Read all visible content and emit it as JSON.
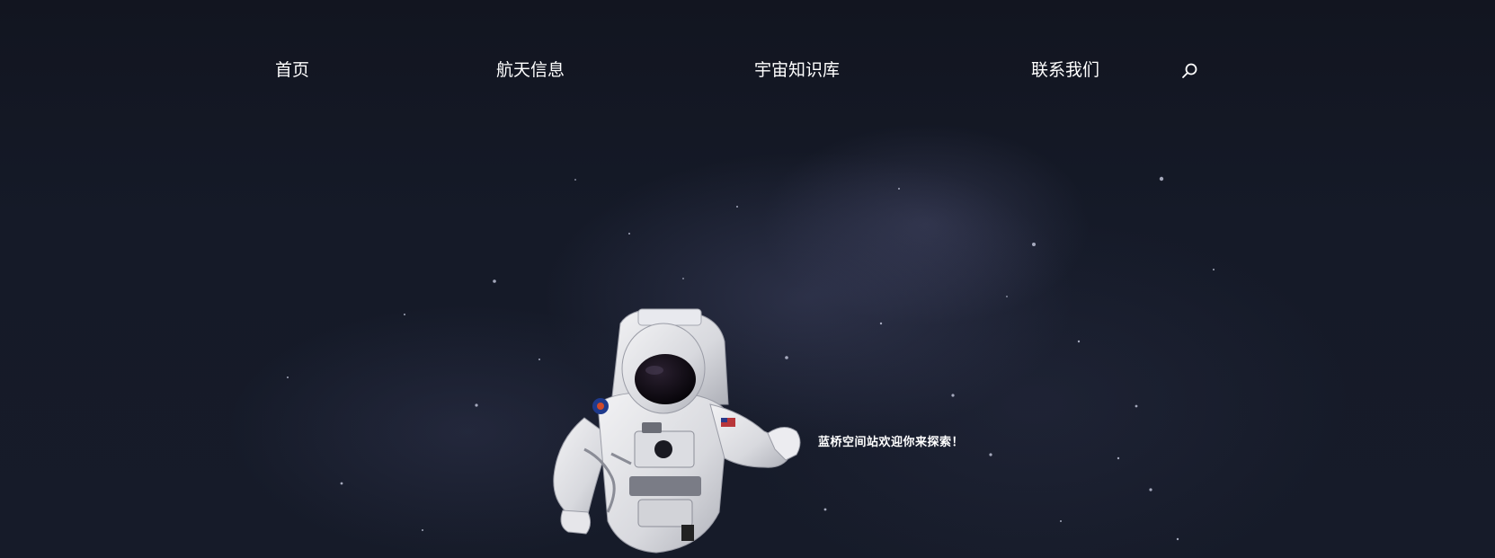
{
  "nav": {
    "items": [
      {
        "label": "首页"
      },
      {
        "label": "航天信息"
      },
      {
        "label": "宇宙知识库"
      },
      {
        "label": "联系我们"
      }
    ],
    "search_icon": "search-icon"
  },
  "hero": {
    "welcome_text": "蓝桥空间站欢迎你来探索！",
    "image": "astronaut-illustration"
  },
  "colors": {
    "background": "#121520",
    "text": "#ffffff"
  }
}
